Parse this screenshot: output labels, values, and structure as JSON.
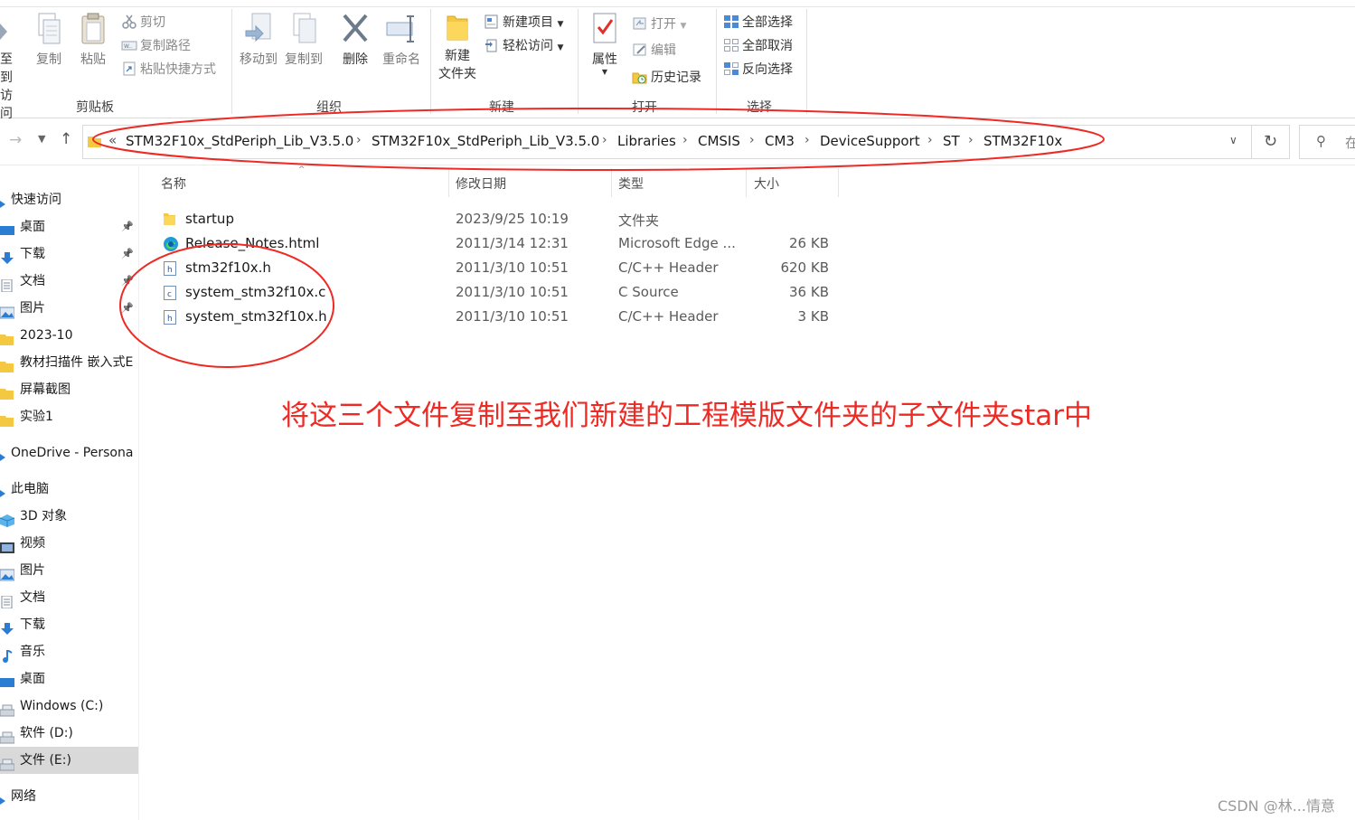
{
  "ribbon": {
    "clipboard": {
      "pin_label_line1": "至到",
      "pin_label_line2": "访问",
      "copy": "复制",
      "paste": "粘贴",
      "cut": "剪切",
      "copy_path": "复制路径",
      "paste_shortcut": "粘贴快捷方式",
      "group": "剪贴板"
    },
    "organize": {
      "move_to": "移动到",
      "copy_to": "复制到",
      "delete": "删除",
      "rename": "重命名",
      "group": "组织"
    },
    "new": {
      "new_folder_line1": "新建",
      "new_folder_line2": "文件夹",
      "new_item": "新建项目",
      "easy_access": "轻松访问",
      "group": "新建"
    },
    "open": {
      "properties": "属性",
      "open": "打开",
      "edit": "编辑",
      "history": "历史记录",
      "group": "打开"
    },
    "select": {
      "select_all": "全部选择",
      "select_none": "全部取消",
      "invert": "反向选择",
      "group": "选择"
    }
  },
  "address": {
    "overflow": "«",
    "crumbs": [
      "STM32F10x_StdPeriph_Lib_V3.5.0",
      "STM32F10x_StdPeriph_Lib_V3.5.0",
      "Libraries",
      "CMSIS",
      "CM3",
      "DeviceSupport",
      "ST",
      "STM32F10x"
    ],
    "search_placeholder": "在"
  },
  "nav_pane": {
    "items": [
      {
        "label": "快速访问",
        "icon": "star-icon",
        "pinned": false
      },
      {
        "label": "桌面",
        "icon": "desktop-icon",
        "pinned": true
      },
      {
        "label": "下载",
        "icon": "download-icon",
        "pinned": true
      },
      {
        "label": "文档",
        "icon": "document-icon",
        "pinned": true
      },
      {
        "label": "图片",
        "icon": "picture-icon",
        "pinned": true
      },
      {
        "label": "2023-10",
        "icon": "folder-icon",
        "pinned": false
      },
      {
        "label": "教材扫描件 嵌入式E",
        "icon": "folder-icon",
        "pinned": false
      },
      {
        "label": "屏幕截图",
        "icon": "folder-icon",
        "pinned": false
      },
      {
        "label": "实验1",
        "icon": "folder-icon",
        "pinned": false
      },
      {
        "label": "OneDrive - Persona",
        "icon": "cloud-icon",
        "pinned": false
      },
      {
        "label": "此电脑",
        "icon": "computer-icon",
        "pinned": false
      },
      {
        "label": "3D 对象",
        "icon": "cube-icon",
        "pinned": false
      },
      {
        "label": "视频",
        "icon": "video-icon",
        "pinned": false
      },
      {
        "label": "图片",
        "icon": "picture-icon",
        "pinned": false
      },
      {
        "label": "文档",
        "icon": "document-icon",
        "pinned": false
      },
      {
        "label": "下载",
        "icon": "download-icon",
        "pinned": false
      },
      {
        "label": "音乐",
        "icon": "music-icon",
        "pinned": false
      },
      {
        "label": "桌面",
        "icon": "desktop-icon",
        "pinned": false
      },
      {
        "label": "Windows (C:)",
        "icon": "drive-icon",
        "pinned": false
      },
      {
        "label": "软件 (D:)",
        "icon": "drive-icon",
        "pinned": false
      },
      {
        "label": "文件 (E:)",
        "icon": "drive-icon",
        "pinned": false,
        "selected": true
      },
      {
        "label": "网络",
        "icon": "network-icon",
        "pinned": false
      }
    ]
  },
  "file_list": {
    "columns": {
      "name": "名称",
      "date": "修改日期",
      "type": "类型",
      "size": "大小"
    },
    "rows": [
      {
        "name": "startup",
        "date": "2023/9/25 10:19",
        "type": "文件夹",
        "size": "",
        "icon": "folder-icon"
      },
      {
        "name": "Release_Notes.html",
        "date": "2011/3/14 12:31",
        "type": "Microsoft Edge ...",
        "size": "26 KB",
        "icon": "edge-icon"
      },
      {
        "name": "stm32f10x.h",
        "date": "2011/3/10 10:51",
        "type": "C/C++ Header",
        "size": "620 KB",
        "icon": "h-file-icon"
      },
      {
        "name": "system_stm32f10x.c",
        "date": "2011/3/10 10:51",
        "type": "C Source",
        "size": "36 KB",
        "icon": "c-file-icon"
      },
      {
        "name": "system_stm32f10x.h",
        "date": "2011/3/10 10:51",
        "type": "C/C++ Header",
        "size": "3 KB",
        "icon": "h-file-icon"
      }
    ]
  },
  "annotation": {
    "text": "将这三个文件复制至我们新建的工程模版文件夹的子文件夹star中",
    "color": "#ee2a24"
  },
  "watermark": "CSDN @林...情意"
}
